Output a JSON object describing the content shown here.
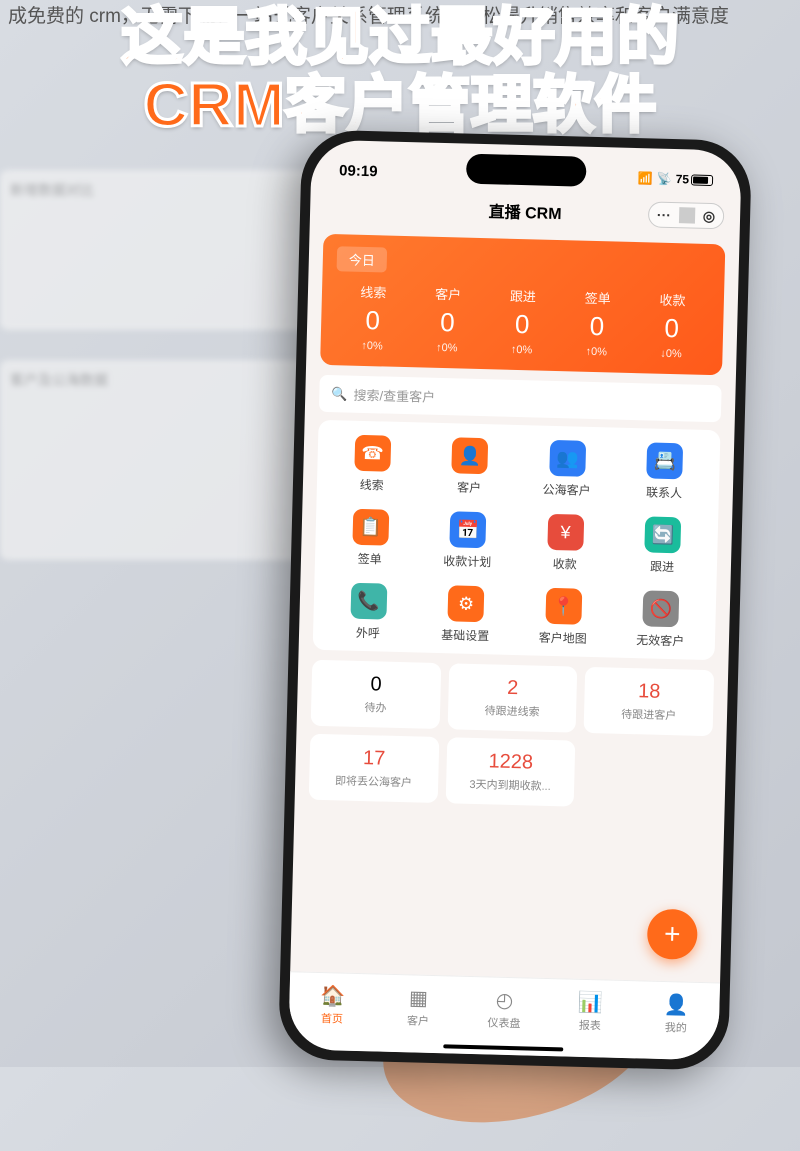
{
  "overlay_caption": "成免费的 crm，无需下载，一站式客户关系管理系统，轻松提升销售效率和客户满意度",
  "headline_line1": "这是我见过最好用的",
  "headline_line2": "CRM客户管理软件",
  "bg": {
    "section1": "新增数据对比",
    "section2": "客户及公海数据"
  },
  "status": {
    "time": "09:19",
    "battery": "75"
  },
  "nav": {
    "title": "直播 CRM",
    "more": "···",
    "target": "◎"
  },
  "card": {
    "today": "今日",
    "metrics": [
      {
        "label": "线索",
        "value": "0",
        "delta": "↑0%"
      },
      {
        "label": "客户",
        "value": "0",
        "delta": "↑0%"
      },
      {
        "label": "跟进",
        "value": "0",
        "delta": "↑0%"
      },
      {
        "label": "签单",
        "value": "0",
        "delta": "↑0%"
      },
      {
        "label": "收款",
        "value": "0",
        "delta": "↓0%"
      }
    ]
  },
  "search": {
    "placeholder": "搜索/查重客户"
  },
  "apps": [
    {
      "name": "线索",
      "color": "#ff6a1a",
      "glyph": "☎"
    },
    {
      "name": "客户",
      "color": "#ff6a1a",
      "glyph": "👤"
    },
    {
      "name": "公海客户",
      "color": "#2e7cf6",
      "glyph": "👥"
    },
    {
      "name": "联系人",
      "color": "#2e7cf6",
      "glyph": "📇"
    },
    {
      "name": "签单",
      "color": "#ff6a1a",
      "glyph": "📋"
    },
    {
      "name": "收款计划",
      "color": "#2e7cf6",
      "glyph": "📅"
    },
    {
      "name": "收款",
      "color": "#e74c3c",
      "glyph": "¥"
    },
    {
      "name": "跟进",
      "color": "#1abc9c",
      "glyph": "🔄"
    },
    {
      "name": "外呼",
      "color": "#3fb5a8",
      "glyph": "📞"
    },
    {
      "name": "基础设置",
      "color": "#ff6a1a",
      "glyph": "⚙"
    },
    {
      "name": "客户地图",
      "color": "#ff6a1a",
      "glyph": "📍"
    },
    {
      "name": "无效客户",
      "color": "#888888",
      "glyph": "🚫"
    }
  ],
  "stats": [
    {
      "value": "0",
      "label": "待办",
      "red": false
    },
    {
      "value": "2",
      "label": "待跟进线索",
      "red": true
    },
    {
      "value": "18",
      "label": "待跟进客户",
      "red": true
    },
    {
      "value": "17",
      "label": "即将丢公海客户",
      "red": true
    },
    {
      "value": "1228",
      "label": "3天内到期收款...",
      "red": true
    }
  ],
  "fab": "+",
  "tabs": [
    {
      "label": "首页",
      "icon": "🏠",
      "active": true
    },
    {
      "label": "客户",
      "icon": "▦",
      "active": false
    },
    {
      "label": "仪表盘",
      "icon": "◴",
      "active": false
    },
    {
      "label": "报表",
      "icon": "📊",
      "active": false
    },
    {
      "label": "我的",
      "icon": "👤",
      "active": false
    }
  ]
}
